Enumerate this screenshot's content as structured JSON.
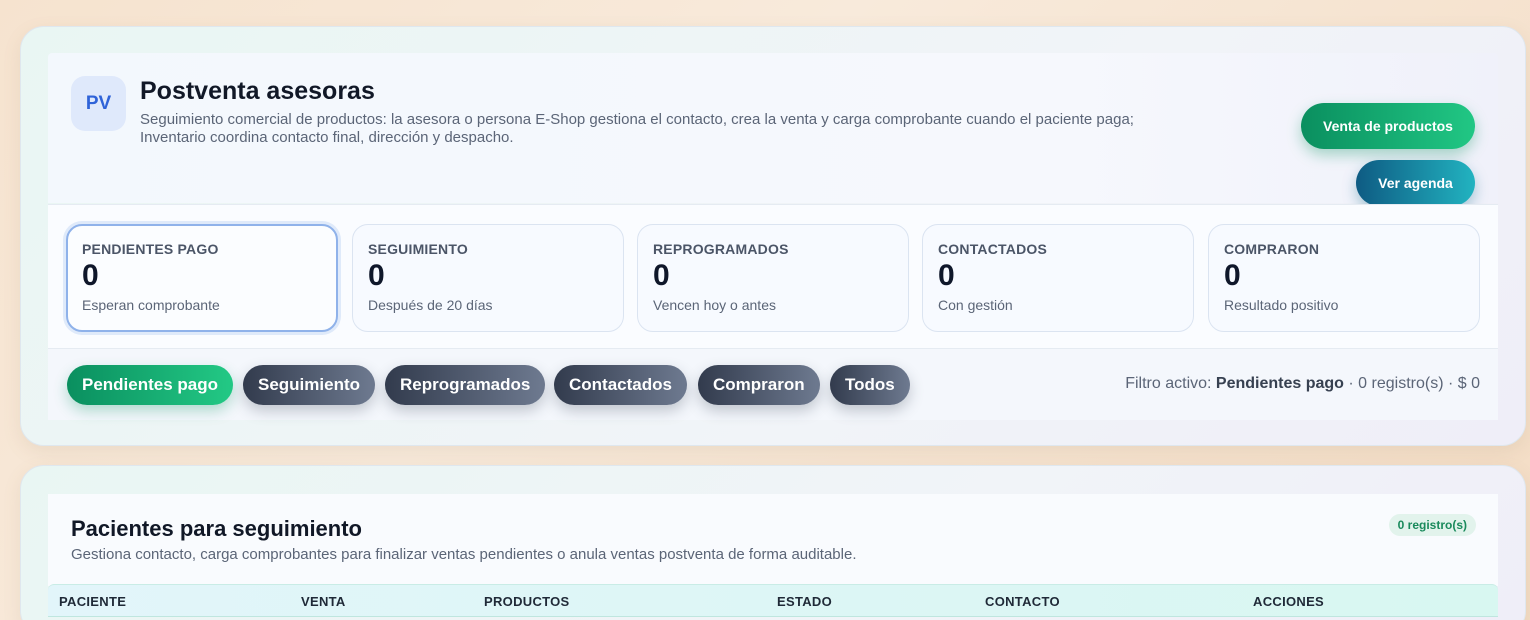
{
  "header": {
    "avatar": "PV",
    "title": "Postventa asesoras",
    "description": "Seguimiento comercial de productos: la asesora o persona E-Shop gestiona el contacto, crea la venta y carga comprobante cuando el paciente paga; Inventario coordina contacto final, dirección y despacho.",
    "primary_button": "Venta de productos",
    "secondary_button": "Ver agenda"
  },
  "stats": [
    {
      "label": "PENDIENTES PAGO",
      "value": "0",
      "sub": "Esperan comprobante"
    },
    {
      "label": "SEGUIMIENTO",
      "value": "0",
      "sub": "Después de 20 días"
    },
    {
      "label": "REPROGRAMADOS",
      "value": "0",
      "sub": "Vencen hoy o antes"
    },
    {
      "label": "CONTACTADOS",
      "value": "0",
      "sub": "Con gestión"
    },
    {
      "label": "COMPRARON",
      "value": "0",
      "sub": "Resultado positivo"
    }
  ],
  "filters": {
    "chips": [
      "Pendientes pago",
      "Seguimiento",
      "Reprogramados",
      "Contactados",
      "Compraron",
      "Todos"
    ],
    "active_prefix": "Filtro activo:",
    "active_name": "Pendientes pago",
    "active_suffix": "· 0 registro(s) · $ 0"
  },
  "list": {
    "title": "Pacientes para seguimiento",
    "description": "Gestiona contacto, carga comprobantes para finalizar ventas pendientes o anula ventas postventa de forma auditable.",
    "count_badge": "0 registro(s)",
    "columns": [
      "PACIENTE",
      "VENTA",
      "PRODUCTOS",
      "ESTADO",
      "CONTACTO",
      "ACCIONES"
    ]
  },
  "colors": {
    "accent_green": "#16b374",
    "accent_teal": "#1684a3",
    "chip_dark": "#3b4458",
    "active_border": "#8fb2ea"
  }
}
